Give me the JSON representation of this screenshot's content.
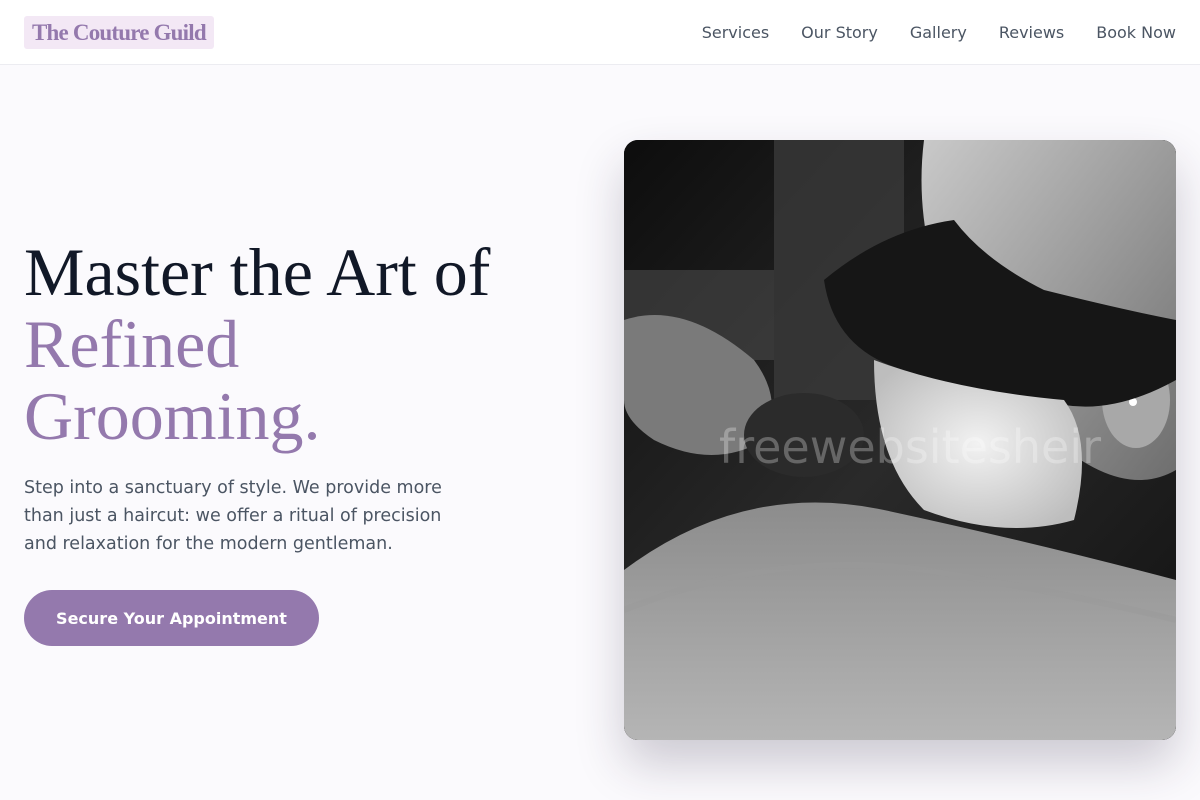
{
  "brand": {
    "name": "The Couture Guild"
  },
  "nav": {
    "items": [
      {
        "label": "Services"
      },
      {
        "label": "Our Story"
      },
      {
        "label": "Gallery"
      },
      {
        "label": "Reviews"
      },
      {
        "label": "Book Now"
      }
    ]
  },
  "hero": {
    "title_line1": "Master the Art of",
    "title_line2": "Refined",
    "title_line3": "Grooming.",
    "description": "Step into a sanctuary of style. We provide more than just a haircut: we offer a ritual of precision and relaxation for the modern gentleman.",
    "cta_label": "Secure Your Appointment",
    "image_watermark": "freewebsitesheir"
  },
  "colors": {
    "accent": "#9479ad",
    "logo_bg": "#f3e8f5",
    "heading": "#111827",
    "body_text": "#4b5563",
    "page_bg": "#fbfafd"
  }
}
